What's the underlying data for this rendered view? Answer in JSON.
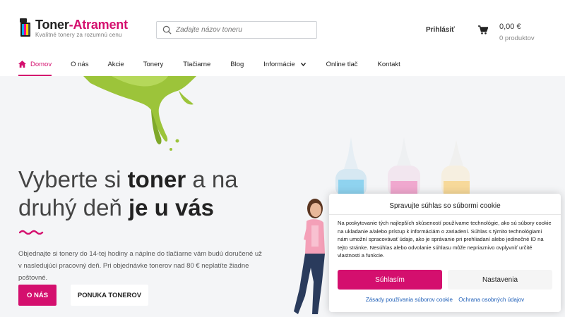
{
  "brand": {
    "name_part1": "Toner",
    "name_part2": "-Atrament",
    "tagline": "Kvalitné tonery za rozumnú cenu",
    "accent": "#d40f6e"
  },
  "search": {
    "placeholder": "Zadajte názov toneru",
    "icon": "search-icon"
  },
  "header": {
    "login_label": "Prihlásiť",
    "cart_total": "0,00 €",
    "cart_count": "0 produktov",
    "cart_icon": "cart-icon"
  },
  "nav": {
    "items": [
      {
        "label": "Domov",
        "icon": "home-icon",
        "active": true
      },
      {
        "label": "O nás"
      },
      {
        "label": "Akcie"
      },
      {
        "label": "Tonery"
      },
      {
        "label": "Tlačiarne"
      },
      {
        "label": "Blog"
      },
      {
        "label": "Informácie",
        "icon": "chevron-down-icon"
      },
      {
        "label": "Online tlač"
      },
      {
        "label": "Kontakt"
      }
    ]
  },
  "hero": {
    "title_p1": "Vyberte si ",
    "title_b1": "toner",
    "title_p2": " a na druhý deň ",
    "title_b2": "je u vás",
    "text": "Objednajte si tonery do 14-tej hodiny a náplne do tlačiarne vám budú doručené už v nasledujúci pracovný deň. Pri objednávke tonerov nad 80 € neplatíte žiadne poštovné.",
    "btn_primary": "O NÁS",
    "btn_secondary": "PONUKA TONEROV"
  },
  "cookie": {
    "title": "Spravujte súhlas so súbormi cookie",
    "text": "Na poskytovanie tých najlepších skúseností používame technológie, ako sú súbory cookie na ukladanie a/alebo prístup k informáciám o zariadení. Súhlas s týmito technológiami nám umožní spracovávať údaje, ako je správanie pri prehliadaní alebo jedinečné ID na tejto stránke. Nesúhlas alebo odvolanie súhlasu môže nepriaznivo ovplyvniť určité vlastnosti a funkcie.",
    "accept_label": "Súhlasím",
    "settings_label": "Nastavenia",
    "link_cookie_policy": "Zásady používania súborov cookie",
    "link_privacy": "Ochrana osobných údajov"
  }
}
